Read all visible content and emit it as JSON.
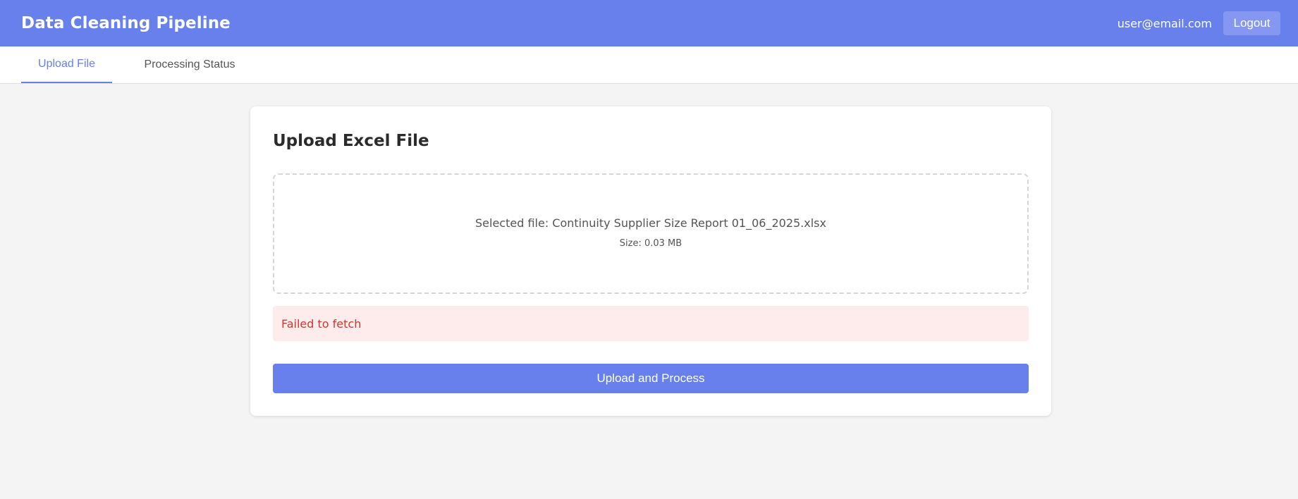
{
  "header": {
    "title": "Data Cleaning Pipeline",
    "user_email": "user@email.com",
    "logout_label": "Logout"
  },
  "tabs": [
    {
      "label": "Upload File",
      "active": true
    },
    {
      "label": "Processing Status",
      "active": false
    }
  ],
  "upload_card": {
    "title": "Upload Excel File",
    "selected_file_text": "Selected file: Continuity Supplier Size Report 01_06_2025.xlsx",
    "file_size_text": "Size: 0.03 MB",
    "error_message": "Failed to fetch",
    "submit_label": "Upload and Process"
  },
  "colors": {
    "primary": "#6780ec",
    "error_text": "#c73a31",
    "error_background": "#fdeceb",
    "page_background": "#f4f4f4"
  }
}
